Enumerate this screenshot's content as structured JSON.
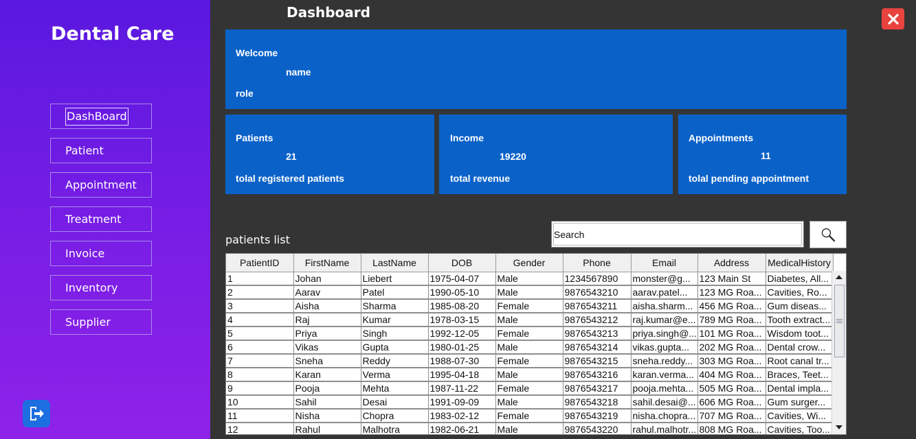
{
  "app": {
    "brand": "Dental Care",
    "page_title": "Dashboard"
  },
  "sidebar": {
    "items": [
      {
        "label": "DashBoard"
      },
      {
        "label": "Patient"
      },
      {
        "label": "Appointment"
      },
      {
        "label": "Treatment"
      },
      {
        "label": "Invoice"
      },
      {
        "label": "Inventory"
      },
      {
        "label": "Supplier"
      }
    ],
    "active": "DashBoard"
  },
  "welcome": {
    "title": "Welcome",
    "name": "name",
    "role": "role"
  },
  "stats": {
    "patients": {
      "title": "Patients",
      "value": "21",
      "caption": "tolal registered patients"
    },
    "income": {
      "title": "Income",
      "value": "19220",
      "caption": "total revenue"
    },
    "appointments": {
      "title": "Appointments",
      "value": "11",
      "caption": "tolal pending appointment"
    }
  },
  "patients_list": {
    "label": "patients list",
    "search_value": "Search",
    "columns": [
      "PatientID",
      "FirstName",
      "LastName",
      "DOB",
      "Gender",
      "Phone",
      "Email",
      "Address",
      "MedicalHistory"
    ],
    "rows": [
      [
        "1",
        "Johan",
        "Liebert",
        "1975-04-07",
        "Male",
        "1234567890",
        "monster@g...",
        "123 Main St",
        "Diabetes, All..."
      ],
      [
        "2",
        "Aarav",
        "Patel",
        "1990-05-10",
        "Male",
        "9876543210",
        "aarav.patel...",
        "123 MG Roa...",
        "Cavities, Ro..."
      ],
      [
        "3",
        "Aisha",
        "Sharma",
        "1985-08-20",
        "Female",
        "9876543211",
        "aisha.sharm...",
        "456 MG Roa...",
        "Gum diseas..."
      ],
      [
        "4",
        "Raj",
        "Kumar",
        "1978-03-15",
        "Male",
        "9876543212",
        "raj.kumar@e...",
        "789 MG Roa...",
        "Tooth extract..."
      ],
      [
        "5",
        "Priya",
        "Singh",
        "1992-12-05",
        "Female",
        "9876543213",
        "priya.singh@...",
        "101 MG Roa...",
        "Wisdom toot..."
      ],
      [
        "6",
        "Vikas",
        "Gupta",
        "1980-01-25",
        "Male",
        "9876543214",
        "vikas.gupta...",
        "202 MG Roa...",
        "Dental crow..."
      ],
      [
        "7",
        "Sneha",
        "Reddy",
        "1988-07-30",
        "Female",
        "9876543215",
        "sneha.reddy...",
        "303 MG Roa...",
        "Root canal tr..."
      ],
      [
        "8",
        "Karan",
        "Verma",
        "1995-04-18",
        "Male",
        "9876543216",
        "karan.verma...",
        "404 MG Roa...",
        "Braces, Teet..."
      ],
      [
        "9",
        "Pooja",
        "Mehta",
        "1987-11-22",
        "Female",
        "9876543217",
        "pooja.mehta...",
        "505 MG Roa...",
        "Dental impla..."
      ],
      [
        "10",
        "Sahil",
        "Desai",
        "1991-09-09",
        "Male",
        "9876543218",
        "sahil.desai@...",
        "606 MG Roa...",
        "Gum surger..."
      ],
      [
        "11",
        "Nisha",
        "Chopra",
        "1983-02-12",
        "Female",
        "9876543219",
        "nisha.chopra...",
        "707 MG Roa...",
        "Cavities, Wi..."
      ],
      [
        "12",
        "Rahul",
        "Malhotra",
        "1982-06-21",
        "Male",
        "9876543220",
        "rahul.malhotr...",
        "808 MG Roa...",
        "Cavities, Too..."
      ]
    ]
  },
  "icons": {
    "logout": "logout-icon",
    "close": "close-icon",
    "search": "search-icon"
  },
  "colors": {
    "sidebar_top": "#5a18df",
    "sidebar_bottom": "#8f22e8",
    "card": "#0a62c9",
    "main_bg": "#343434",
    "close": "#e8433f"
  }
}
